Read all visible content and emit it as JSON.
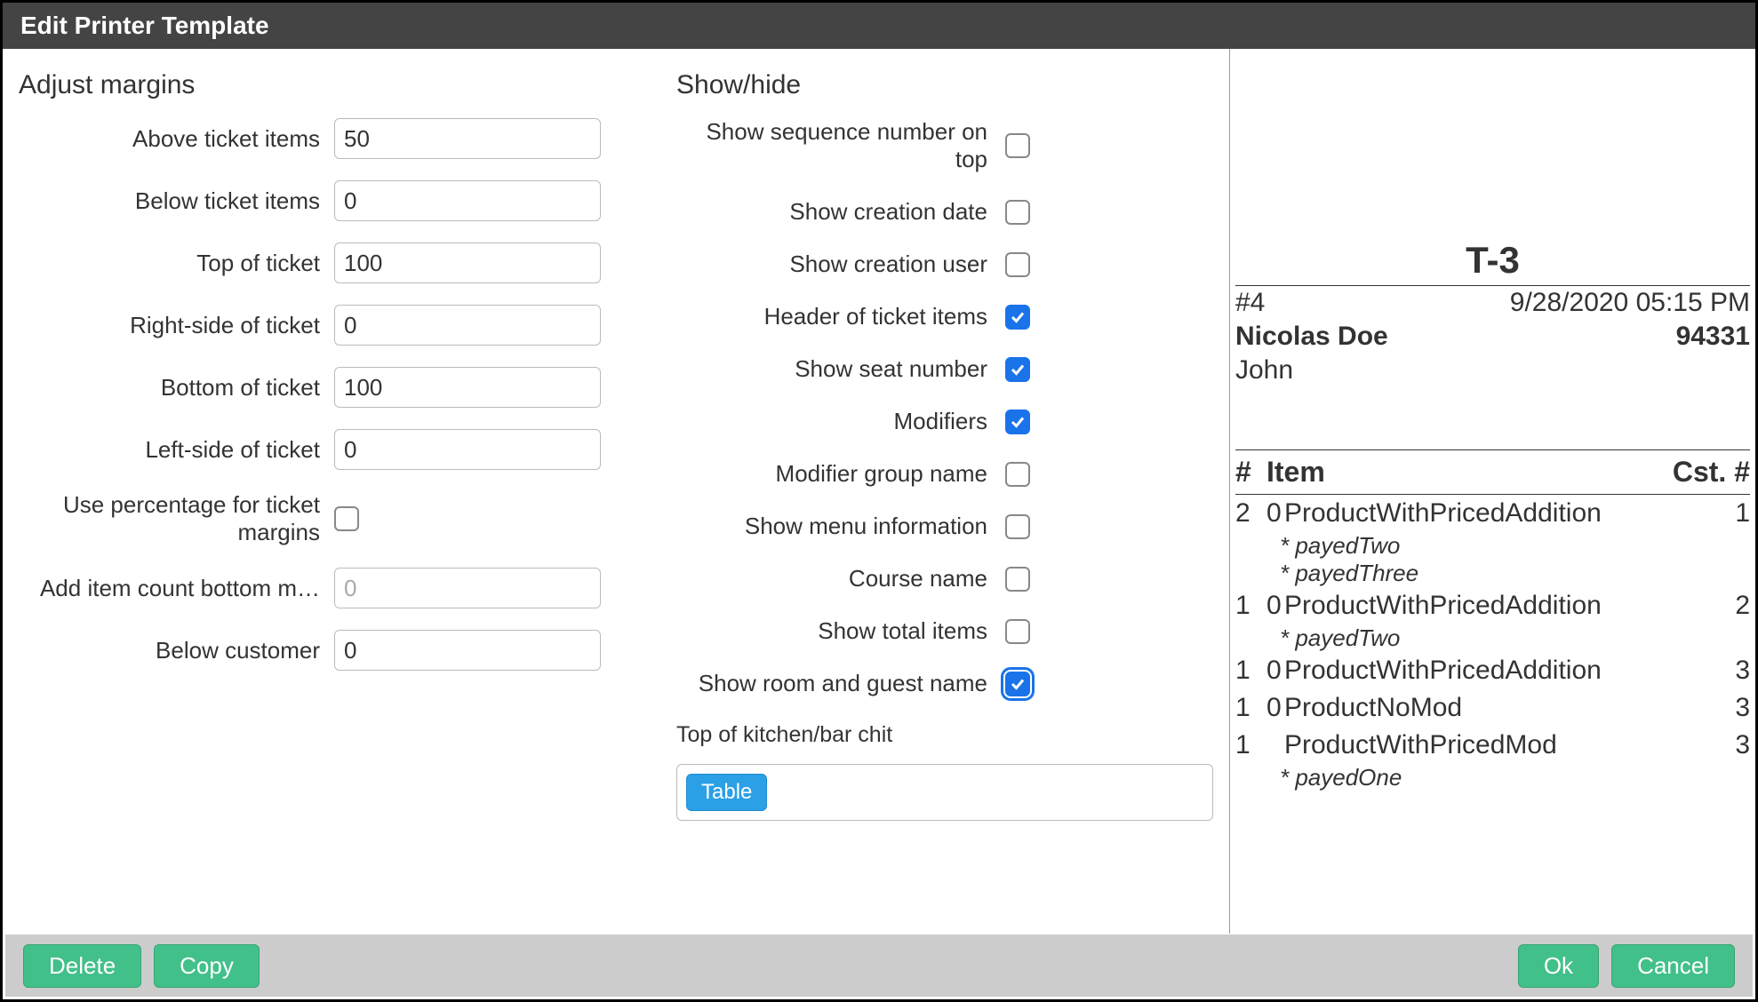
{
  "titlebar": "Edit Printer Template",
  "margins": {
    "section_title": "Adjust margins",
    "above_items": {
      "label": "Above ticket items",
      "value": "50"
    },
    "below_items": {
      "label": "Below ticket items",
      "value": "0"
    },
    "top": {
      "label": "Top of ticket",
      "value": "100"
    },
    "right": {
      "label": "Right-side of ticket",
      "value": "0"
    },
    "bottom": {
      "label": "Bottom of ticket",
      "value": "100"
    },
    "left": {
      "label": "Left-side of ticket",
      "value": "0"
    },
    "use_percent": {
      "label": "Use percentage for ticket margins",
      "checked": false
    },
    "item_count_margin": {
      "label": "Add item count bottom m…",
      "value": "0"
    },
    "below_customer": {
      "label": "Below customer",
      "value": "0"
    }
  },
  "showhide": {
    "section_title": "Show/hide",
    "options": {
      "seq_top": {
        "label": "Show sequence number on top",
        "checked": false
      },
      "creation_date": {
        "label": "Show creation date",
        "checked": false
      },
      "creation_user": {
        "label": "Show creation user",
        "checked": false
      },
      "header_items": {
        "label": "Header of ticket items",
        "checked": true
      },
      "seat_number": {
        "label": "Show seat number",
        "checked": true
      },
      "modifiers": {
        "label": "Modifiers",
        "checked": true
      },
      "mod_group_name": {
        "label": "Modifier group name",
        "checked": false
      },
      "menu_info": {
        "label": "Show menu information",
        "checked": false
      },
      "course_name": {
        "label": "Course name",
        "checked": false
      },
      "total_items": {
        "label": "Show total items",
        "checked": false
      },
      "room_guest": {
        "label": "Show room and guest name",
        "checked": true,
        "focused": true
      }
    },
    "top_chit_label": "Top of kitchen/bar chit",
    "tag": "Table"
  },
  "preview": {
    "title": "T-3",
    "seq": "#4",
    "datetime": "9/28/2020 05:15 PM",
    "customer": "Nicolas Doe",
    "ref": "94331",
    "server": "John",
    "header": {
      "qty": "#",
      "item": "Item",
      "cst": "Cst. #"
    },
    "items": [
      {
        "qty": "2",
        "seat": "0",
        "name": "ProductWithPricedAddition",
        "cst": "1",
        "mods": [
          "* payedTwo",
          "* payedThree"
        ]
      },
      {
        "qty": "1",
        "seat": "0",
        "name": "ProductWithPricedAddition",
        "cst": "2",
        "mods": [
          "* payedTwo"
        ]
      },
      {
        "qty": "1",
        "seat": "0",
        "name": "ProductWithPricedAddition",
        "cst": "3",
        "mods": []
      },
      {
        "qty": "1",
        "seat": "0",
        "name": "ProductNoMod",
        "cst": "3",
        "mods": []
      },
      {
        "qty": "1",
        "seat": "",
        "name": "ProductWithPricedMod",
        "cst": "3",
        "mods": [
          "* payedOne"
        ]
      }
    ]
  },
  "footer": {
    "delete": "Delete",
    "copy": "Copy",
    "ok": "Ok",
    "cancel": "Cancel"
  }
}
